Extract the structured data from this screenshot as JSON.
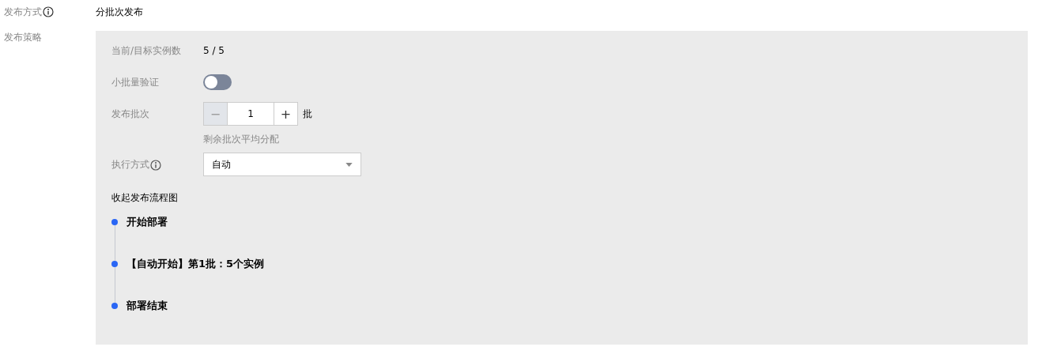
{
  "publish_method": {
    "label": "发布方式",
    "value": "分批次发布"
  },
  "strategy": {
    "label": "发布策略",
    "instance_count": {
      "label": "当前/目标实例数",
      "value": "5 / 5"
    },
    "small_batch": {
      "label": "小批量验证",
      "on": false
    },
    "batches": {
      "label": "发布批次",
      "minus": "−",
      "value": "1",
      "plus": "+",
      "minus_disabled": true,
      "unit": "批",
      "hint": "剩余批次平均分配"
    },
    "execution": {
      "label": "执行方式",
      "value": "自动"
    },
    "collapse_link": "收起发布流程图",
    "steps": [
      {
        "text": "开始部署"
      },
      {
        "text": "【自动开始】第1批：5个实例"
      },
      {
        "text": "部署结束"
      }
    ]
  }
}
